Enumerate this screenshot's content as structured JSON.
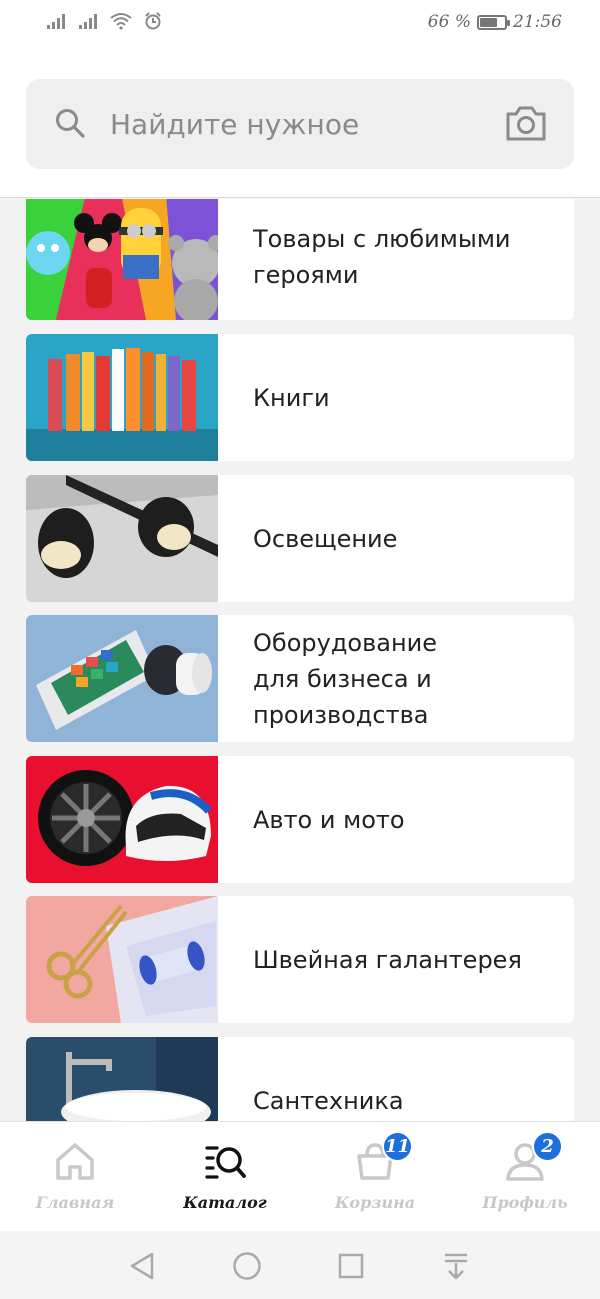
{
  "status_bar": {
    "battery_percent": "66 %",
    "battery_level": 0.66,
    "time": "21:56"
  },
  "search": {
    "placeholder": "Найдите нужное",
    "icon": "search-icon",
    "camera_icon": "camera-icon"
  },
  "categories": [
    {
      "label": "Товары с любимыми героями"
    },
    {
      "label": "Книги"
    },
    {
      "label": "Освещение"
    },
    {
      "label": "Оборудование для бизнеса и производства"
    },
    {
      "label": "Авто и мото"
    },
    {
      "label": "Швейная галантерея"
    },
    {
      "label": "Сантехника"
    }
  ],
  "tabs": [
    {
      "label": "Главная",
      "icon": "home-icon",
      "active": false
    },
    {
      "label": "Каталог",
      "icon": "catalog-search-icon",
      "active": true
    },
    {
      "label": "Корзина",
      "icon": "basket-icon",
      "active": false,
      "badge": "11"
    },
    {
      "label": "Профиль",
      "icon": "profile-icon",
      "active": false,
      "badge": "2"
    }
  ],
  "colors": {
    "accent": "#1e6fd9",
    "background": "#f2f2f2",
    "card": "#ffffff",
    "inactive_tab": "#c8c8c8"
  }
}
